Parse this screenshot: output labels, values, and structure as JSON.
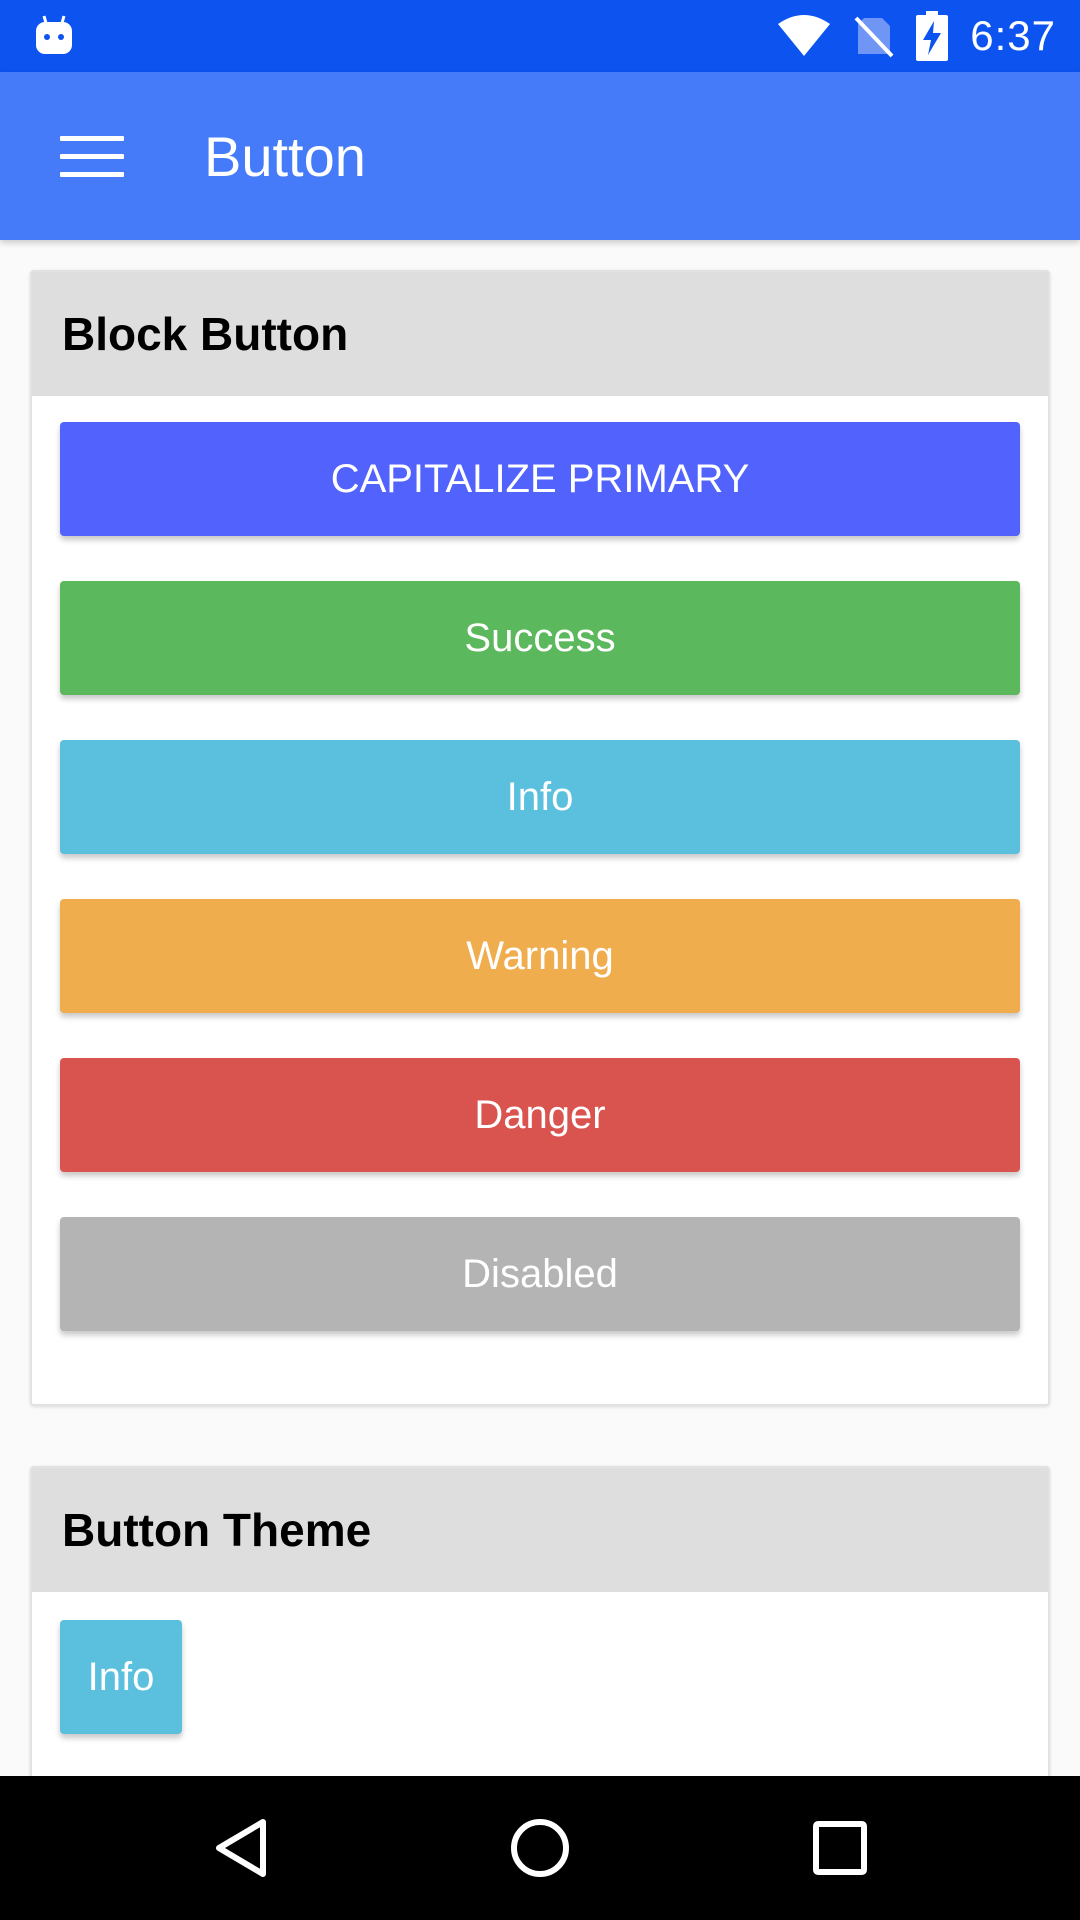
{
  "status_bar": {
    "time": "6:37",
    "icons": [
      "android-bot-icon",
      "wifi-icon",
      "no-sim-icon",
      "battery-charging-icon"
    ]
  },
  "app_bar": {
    "title": "Button",
    "menu_icon": "hamburger-menu-icon"
  },
  "block_button_card": {
    "title": "Block Button",
    "buttons": [
      {
        "label": "CAPITALIZE PRIMARY",
        "color": "#5163fc"
      },
      {
        "label": "Success",
        "color": "#5cb85c"
      },
      {
        "label": "Info",
        "color": "#5bc0de"
      },
      {
        "label": "Warning",
        "color": "#f0ad4e"
      },
      {
        "label": "Danger",
        "color": "#d9534f"
      },
      {
        "label": "Disabled",
        "color": "#b4b4b4"
      }
    ]
  },
  "button_theme_card": {
    "title": "Button Theme",
    "buttons": [
      {
        "label": "Info",
        "color": "#5bc0de"
      }
    ]
  },
  "nav_bar": {
    "icons": [
      "back-icon",
      "home-icon",
      "recents-icon"
    ]
  },
  "colors": {
    "status_bar": "#0c53f0",
    "app_bar": "#457bf8",
    "card_header": "#dedede"
  }
}
